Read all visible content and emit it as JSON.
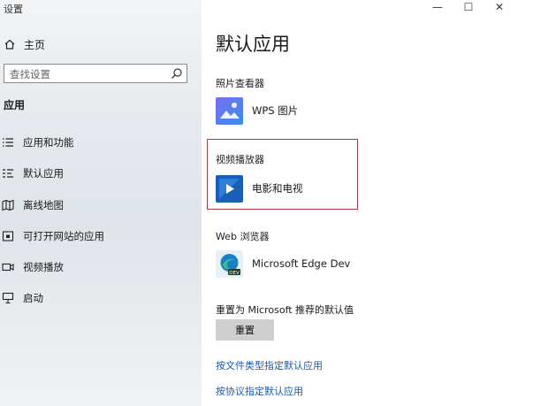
{
  "window": {
    "title": "设置",
    "minimize": "—",
    "maximize": "☐",
    "close": "✕"
  },
  "sidebar": {
    "home_label": "主页",
    "search_placeholder": "查找设置",
    "section_label": "应用",
    "items": [
      {
        "label": "应用和功能",
        "icon": "list-icon"
      },
      {
        "label": "默认应用",
        "icon": "default-apps-icon"
      },
      {
        "label": "离线地图",
        "icon": "map-icon"
      },
      {
        "label": "可打开网站的应用",
        "icon": "website-icon"
      },
      {
        "label": "视频播放",
        "icon": "video-icon"
      },
      {
        "label": "启动",
        "icon": "startup-icon"
      }
    ]
  },
  "main": {
    "title": "默认应用",
    "photo_viewer": {
      "category": "照片查看器",
      "app": "WPS 图片"
    },
    "video_player": {
      "category": "视频播放器",
      "app": "电影和电视"
    },
    "browser": {
      "category": "Web 浏览器",
      "app": "Microsoft Edge Dev"
    },
    "reset_label": "重置为 Microsoft 推荐的默认值",
    "reset_button": "重置",
    "links": [
      "按文件类型指定默认应用",
      "按协议指定默认应用"
    ],
    "highlight_color": "#b3373d",
    "link_color": "#1f5aa6"
  }
}
